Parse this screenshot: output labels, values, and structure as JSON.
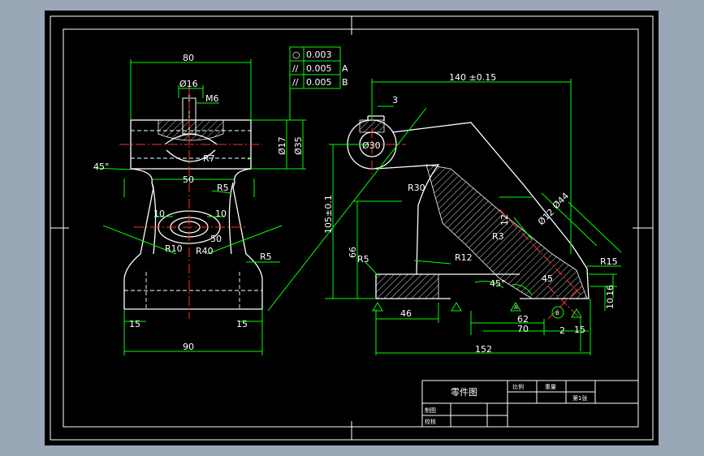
{
  "front_view": {
    "dim_80": "80",
    "dim_dia16": "Ø16",
    "dim_m6": "M6",
    "dim_dia17": "Ø17",
    "dim_dia35": "Ø35",
    "dim_r7": "R7",
    "dim_45deg": "45°",
    "dim_50": "50",
    "dim_r5_top": "R5",
    "dim_10_left": "10",
    "dim_10_right": "10",
    "dim_r10": "R10",
    "dim_r40": "R40",
    "dim_50_lower": "50",
    "dim_r5_right": "R5",
    "dim_15_left": "15",
    "dim_15_right": "15",
    "dim_90": "90"
  },
  "tolerance_frame": {
    "rows": [
      {
        "symbol": "○",
        "value": "0.003",
        "datum": ""
      },
      {
        "symbol": "//",
        "value": "0.005",
        "datum": "A"
      },
      {
        "symbol": "//",
        "value": "0.005",
        "datum": "B"
      }
    ]
  },
  "side_view": {
    "dim_140": "140 ±0.15",
    "dim_3": "3",
    "dim_dia30": "Ø30",
    "dim_r30": "R30",
    "dim_105": "105±0.1",
    "dim_66": "66",
    "dim_r5": "R5",
    "dim_r12": "R12",
    "dim_r3": "R3",
    "dim_12": "12",
    "dim_dia44": "Ø44",
    "dim_dia12": "Ø12",
    "dim_r15": "R15",
    "dim_45deg": "45°",
    "dim_45": "45",
    "dim_16": "16",
    "dim_10": "10",
    "dim_46": "46",
    "dim_70": "70",
    "dim_62": "62",
    "dim_2": "2",
    "dim_15": "15",
    "dim_152": "152",
    "datum_a": "A",
    "datum_b": "B"
  },
  "title_block": {
    "part_name": "零件图",
    "scale_label": "比例",
    "weight_label": "重量",
    "sheet_label": "第1张",
    "drawn_label": "制图",
    "checked_label": "校核"
  },
  "colors": {
    "outline": "#ffffff",
    "dimension": "#00ff00",
    "centerline": "#ff0000",
    "frame": "#ffffff"
  }
}
